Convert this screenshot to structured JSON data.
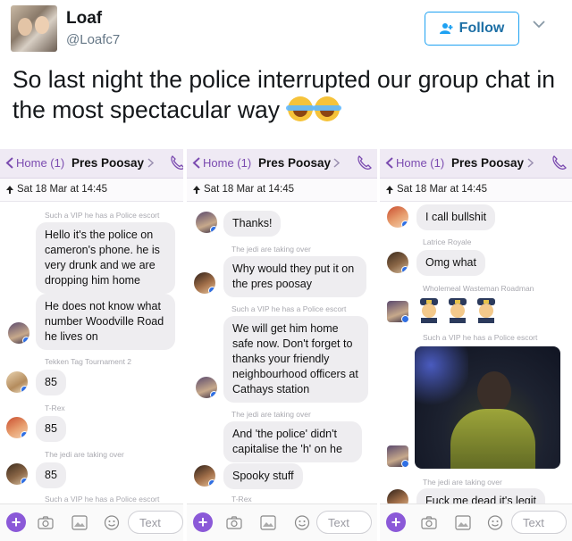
{
  "tweet": {
    "name": "Loaf",
    "handle": "@Loafc7",
    "follow_label": "Follow",
    "text": "So last night the police interrupted our group chat in the most spectacular way"
  },
  "panels": [
    {
      "back_label": "Home (1)",
      "title": "Pres Poosay",
      "pinned": "Sat 18 Mar at 14:45",
      "messages": [
        {
          "type": "system",
          "text": "Such a VIP he has a Police escort"
        },
        {
          "type": "bubble",
          "text": "Hello it's the police on cameron's phone. he is very drunk and we are dropping him home"
        },
        {
          "type": "bubble",
          "text": "He does not know what number Woodville Road he lives on"
        },
        {
          "type": "system",
          "text": "Tekken Tag Tournament 2"
        },
        {
          "type": "bubble",
          "text": "85"
        },
        {
          "type": "system",
          "text": "T-Rex"
        },
        {
          "type": "bubble",
          "text": "85"
        },
        {
          "type": "system",
          "text": "The jedi are taking over"
        },
        {
          "type": "bubble",
          "text": "85"
        },
        {
          "type": "system",
          "text": "Such a VIP he has a Police escort"
        }
      ],
      "input_placeholder": "Text"
    },
    {
      "back_label": "Home (1)",
      "title": "Pres Poosay",
      "pinned": "Sat 18 Mar at 14:45",
      "messages": [
        {
          "type": "bubble",
          "text": "Thanks!"
        },
        {
          "type": "system",
          "text": "The jedi are taking over"
        },
        {
          "type": "bubble",
          "text": "Why would they put it on the pres poosay"
        },
        {
          "type": "system",
          "text": "Such a VIP he has a Police escort"
        },
        {
          "type": "bubble",
          "text": "We will get him home safe now.  Don't forget to thanks your friendly neighbourhood officers at Cathays station"
        },
        {
          "type": "system",
          "text": "The jedi are taking over"
        },
        {
          "type": "bubble",
          "text": "And 'the police' didn't capitalise the 'h' on he"
        },
        {
          "type": "bubble",
          "text": "Spooky stuff"
        },
        {
          "type": "system",
          "text": "T-Rex"
        }
      ],
      "input_placeholder": "Text"
    },
    {
      "back_label": "Home (1)",
      "title": "Pres Poosay",
      "pinned": "Sat 18 Mar at 14:45",
      "messages": [
        {
          "type": "bubble",
          "text": "I call bullshit"
        },
        {
          "type": "system",
          "text": "Latrice Royale"
        },
        {
          "type": "bubble",
          "text": "Omg what"
        },
        {
          "type": "system",
          "text": "Wholemeal Wasteman Roadman"
        },
        {
          "type": "system",
          "text": "Such a VIP he has a Police escort"
        },
        {
          "type": "system",
          "text": "The jedi are taking over"
        },
        {
          "type": "bubble",
          "text": "Fuck me dead it's legit"
        }
      ],
      "input_placeholder": "Text"
    }
  ],
  "colors": {
    "accent": "#7b4bb0",
    "twitter_blue": "#1da1f2",
    "bubble": "#eeedf0"
  },
  "icons": [
    "person-add-icon",
    "chevron-down-icon",
    "phone-icon",
    "camera-icon",
    "image-icon",
    "sticker-icon",
    "plus-icon",
    "pin-icon"
  ]
}
